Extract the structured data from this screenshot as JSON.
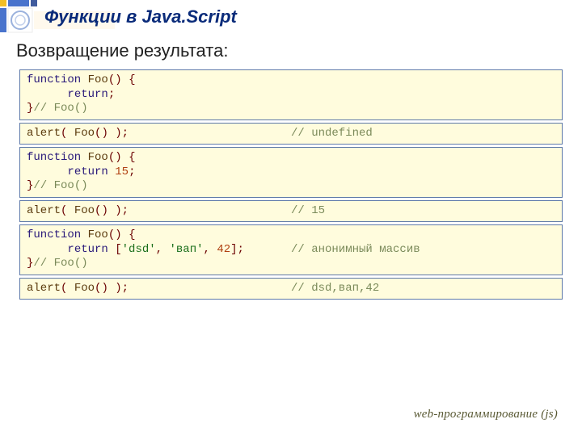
{
  "title": "Функции в Java.Script",
  "subtitle": "Возвращение результата:",
  "footer": "web-программирование (js)",
  "blocks": [
    {
      "lines": [
        [
          {
            "t": "kw",
            "v": "function"
          },
          {
            "t": "sp",
            "v": " "
          },
          {
            "t": "fn",
            "v": "Foo"
          },
          {
            "t": "par",
            "v": "()"
          },
          {
            "t": "sp",
            "v": " "
          },
          {
            "t": "par",
            "v": "{"
          }
        ],
        [
          {
            "t": "indent",
            "v": "      "
          },
          {
            "t": "kw",
            "v": "return"
          },
          {
            "t": "op",
            "v": ";"
          }
        ],
        [
          {
            "t": "par",
            "v": "}"
          },
          {
            "t": "com",
            "v": "// Foo()"
          }
        ]
      ]
    },
    {
      "left": [
        {
          "t": "fn",
          "v": "alert"
        },
        {
          "t": "par",
          "v": "("
        },
        {
          "t": "sp",
          "v": " "
        },
        {
          "t": "fn",
          "v": "Foo"
        },
        {
          "t": "par",
          "v": "()"
        },
        {
          "t": "sp",
          "v": " "
        },
        {
          "t": "par",
          "v": ")"
        },
        {
          "t": "op",
          "v": ";"
        }
      ],
      "right": [
        {
          "t": "com",
          "v": "// undefined"
        }
      ]
    },
    {
      "lines": [
        [
          {
            "t": "kw",
            "v": "function"
          },
          {
            "t": "sp",
            "v": " "
          },
          {
            "t": "fn",
            "v": "Foo"
          },
          {
            "t": "par",
            "v": "()"
          },
          {
            "t": "sp",
            "v": " "
          },
          {
            "t": "par",
            "v": "{"
          }
        ],
        [
          {
            "t": "indent",
            "v": "      "
          },
          {
            "t": "kw",
            "v": "return"
          },
          {
            "t": "sp",
            "v": " "
          },
          {
            "t": "num",
            "v": "15"
          },
          {
            "t": "op",
            "v": ";"
          }
        ],
        [
          {
            "t": "par",
            "v": "}"
          },
          {
            "t": "com",
            "v": "// Foo()"
          }
        ]
      ]
    },
    {
      "left": [
        {
          "t": "fn",
          "v": "alert"
        },
        {
          "t": "par",
          "v": "("
        },
        {
          "t": "sp",
          "v": " "
        },
        {
          "t": "fn",
          "v": "Foo"
        },
        {
          "t": "par",
          "v": "()"
        },
        {
          "t": "sp",
          "v": " "
        },
        {
          "t": "par",
          "v": ")"
        },
        {
          "t": "op",
          "v": ";"
        }
      ],
      "right": [
        {
          "t": "com",
          "v": "// 15"
        }
      ]
    },
    {
      "lines": [
        [
          {
            "t": "kw",
            "v": "function"
          },
          {
            "t": "sp",
            "v": " "
          },
          {
            "t": "fn",
            "v": "Foo"
          },
          {
            "t": "par",
            "v": "()"
          },
          {
            "t": "sp",
            "v": " "
          },
          {
            "t": "par",
            "v": "{"
          }
        ],
        [
          {
            "t": "indent",
            "v": "      "
          },
          {
            "t": "kw",
            "v": "return"
          },
          {
            "t": "sp",
            "v": " "
          },
          {
            "t": "par",
            "v": "["
          },
          {
            "t": "str",
            "v": "'dsd'"
          },
          {
            "t": "op",
            "v": ","
          },
          {
            "t": "sp",
            "v": " "
          },
          {
            "t": "str",
            "v": "'вап'"
          },
          {
            "t": "op",
            "v": ","
          },
          {
            "t": "sp",
            "v": " "
          },
          {
            "t": "num",
            "v": "42"
          },
          {
            "t": "par",
            "v": "]"
          },
          {
            "t": "op",
            "v": ";"
          }
        ],
        [
          {
            "t": "par",
            "v": "}"
          },
          {
            "t": "com",
            "v": "// Foo()"
          }
        ]
      ],
      "right": [
        {
          "t": "com",
          "v": "// анонимный массив"
        }
      ]
    },
    {
      "left": [
        {
          "t": "fn",
          "v": "alert"
        },
        {
          "t": "par",
          "v": "("
        },
        {
          "t": "sp",
          "v": " "
        },
        {
          "t": "fn",
          "v": "Foo"
        },
        {
          "t": "par",
          "v": "()"
        },
        {
          "t": "sp",
          "v": " "
        },
        {
          "t": "par",
          "v": ")"
        },
        {
          "t": "op",
          "v": ";"
        }
      ],
      "right": [
        {
          "t": "com",
          "v": "// dsd,вап,42"
        }
      ]
    }
  ]
}
